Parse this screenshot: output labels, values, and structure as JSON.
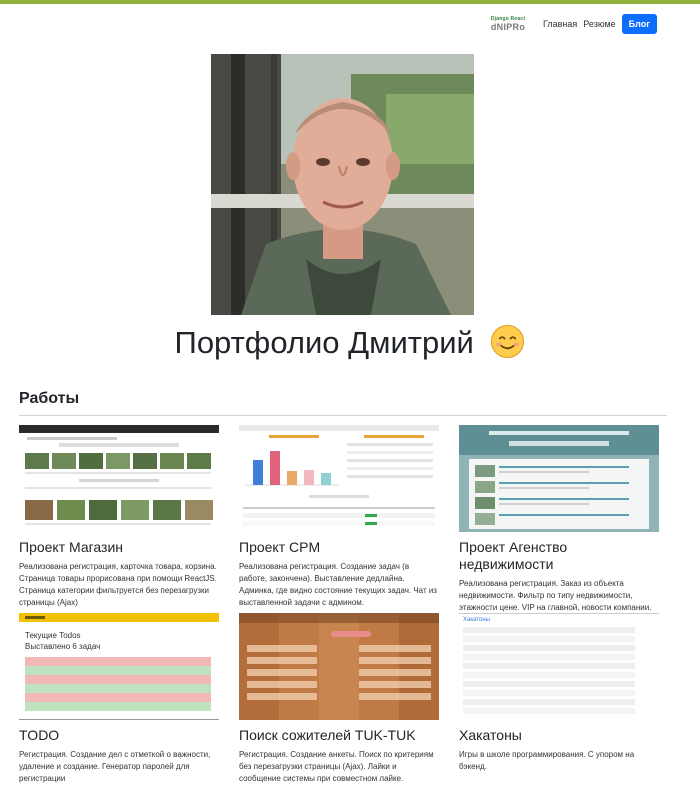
{
  "nav": {
    "brand_top": "Django React",
    "brand_bottom": "dNIPRo",
    "links": [
      "Главная",
      "Резюме"
    ],
    "active_button": "Блог"
  },
  "header": {
    "title": "Портфолио Дмитрий"
  },
  "section": {
    "heading": "Работы"
  },
  "projects": [
    {
      "title": "Проект Магазин",
      "description": "Реализована регистрация, карточка товара, корзина. Страница товары прорисована при помощи ReactJS. Страница категории фильтруется без перезагрузки страницы (Ajax)"
    },
    {
      "title": "Проект CPM",
      "description": "Реализована регистрация. Создание задач (в работе, закончена). Выставление дедлайна. Админка, где видно состояние текущих задач. Чат из выставленной задачи с админом."
    },
    {
      "title": "Проект Агенство недвижимости",
      "description": "Реализована регистрация. Заказ из объекта недвижимости. Фильтр по типу недвижимости, этажности цене. VIP на главной, новости компании."
    },
    {
      "title": "TODO",
      "description": "Регистрация. Создание дел с отметкой о важности, удаление и создание. Генератор паролей для регистрации"
    },
    {
      "title": "Поиск сожителей TUK-TUK",
      "description": "Регистрация. Создание анкеты. Поиск по критериям без перезагрузки страницы (Ajax). Лайки и сообщение системы при совместном лайке."
    },
    {
      "title": "Хакатоны",
      "description": "Игры в школе программирования. С упором на бэкенд."
    }
  ],
  "thumbs": {
    "todo_heading": "Текущие Todos",
    "todo_count": "Выставлено 6 задач",
    "hack_title": "Хакатоны"
  },
  "colors": {
    "accent_bar": "#8fb13c",
    "primary_button": "#0d6efd"
  }
}
